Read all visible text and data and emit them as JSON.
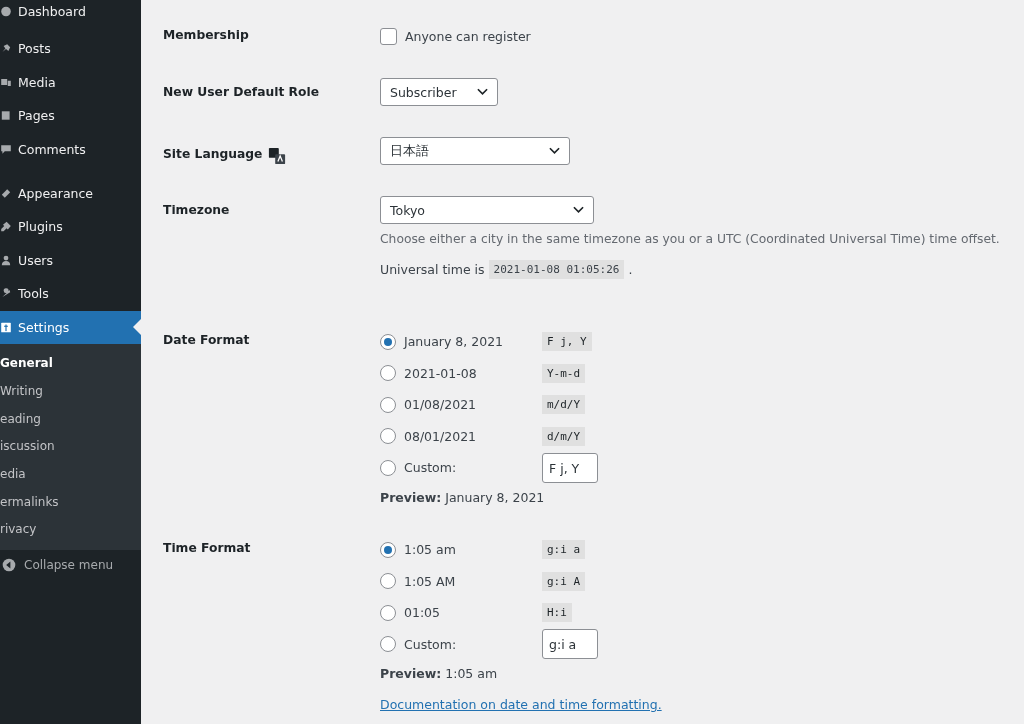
{
  "sidebar": {
    "items": [
      {
        "label": "Dashboard",
        "selected": false
      },
      {
        "label": "Posts",
        "selected": false
      },
      {
        "label": "Media",
        "selected": false
      },
      {
        "label": "Pages",
        "selected": false
      },
      {
        "label": "Comments",
        "selected": false
      },
      {
        "label": "Appearance",
        "selected": false
      },
      {
        "label": "Plugins",
        "selected": false
      },
      {
        "label": "Users",
        "selected": false
      },
      {
        "label": "Tools",
        "selected": false
      },
      {
        "label": "Settings",
        "selected": true
      }
    ],
    "submenu": [
      {
        "label": "General",
        "selected": true
      },
      {
        "label": "Writing",
        "selected": false
      },
      {
        "label": "eading",
        "selected": false
      },
      {
        "label": "iscussion",
        "selected": false
      },
      {
        "label": "edia",
        "selected": false
      },
      {
        "label": "ermalinks",
        "selected": false
      },
      {
        "label": "rivacy",
        "selected": false
      }
    ],
    "collapse": "Collapse menu"
  },
  "settings": {
    "membership": {
      "label": "Membership",
      "checkbox_label": "Anyone can register",
      "checked": false
    },
    "role": {
      "label": "New User Default Role",
      "value": "Subscriber"
    },
    "language": {
      "label": "Site Language",
      "value": "日本語"
    },
    "timezone": {
      "label": "Timezone",
      "value": "Tokyo",
      "description": "Choose either a city in the same timezone as you or a UTC (Coordinated Universal Time) time offset.",
      "universal_label": "Universal time is",
      "universal_value": "2021-01-08 01:05:26",
      "universal_end": "."
    },
    "date_format": {
      "label": "Date Format",
      "options": [
        {
          "label": "January 8, 2021",
          "code": "F j, Y",
          "kind": "preset",
          "selected": true
        },
        {
          "label": "2021-01-08",
          "code": "Y-m-d",
          "kind": "preset",
          "selected": false
        },
        {
          "label": "01/08/2021",
          "code": "m/d/Y",
          "kind": "preset",
          "selected": false
        },
        {
          "label": "08/01/2021",
          "code": "d/m/Y",
          "kind": "preset",
          "selected": false
        },
        {
          "label": "Custom:",
          "code": "F j, Y",
          "kind": "custom",
          "selected": false
        }
      ],
      "preview": "**Preview:** January 8, 2021"
    },
    "time_format": {
      "label": "Time Format",
      "options": [
        {
          "label": "1:05 am",
          "code": "g:i a",
          "kind": "preset",
          "selected": true
        },
        {
          "label": "1:05 AM",
          "code": "g:i A",
          "kind": "preset",
          "selected": false
        },
        {
          "label": "01:05",
          "code": "H:i",
          "kind": "preset",
          "selected": false
        },
        {
          "label": "Custom:",
          "code": "g:i a",
          "kind": "custom",
          "selected": false
        }
      ],
      "preview": "**Preview:** 1:05 am"
    },
    "doc_link": "Documentation on date and time formatting."
  }
}
